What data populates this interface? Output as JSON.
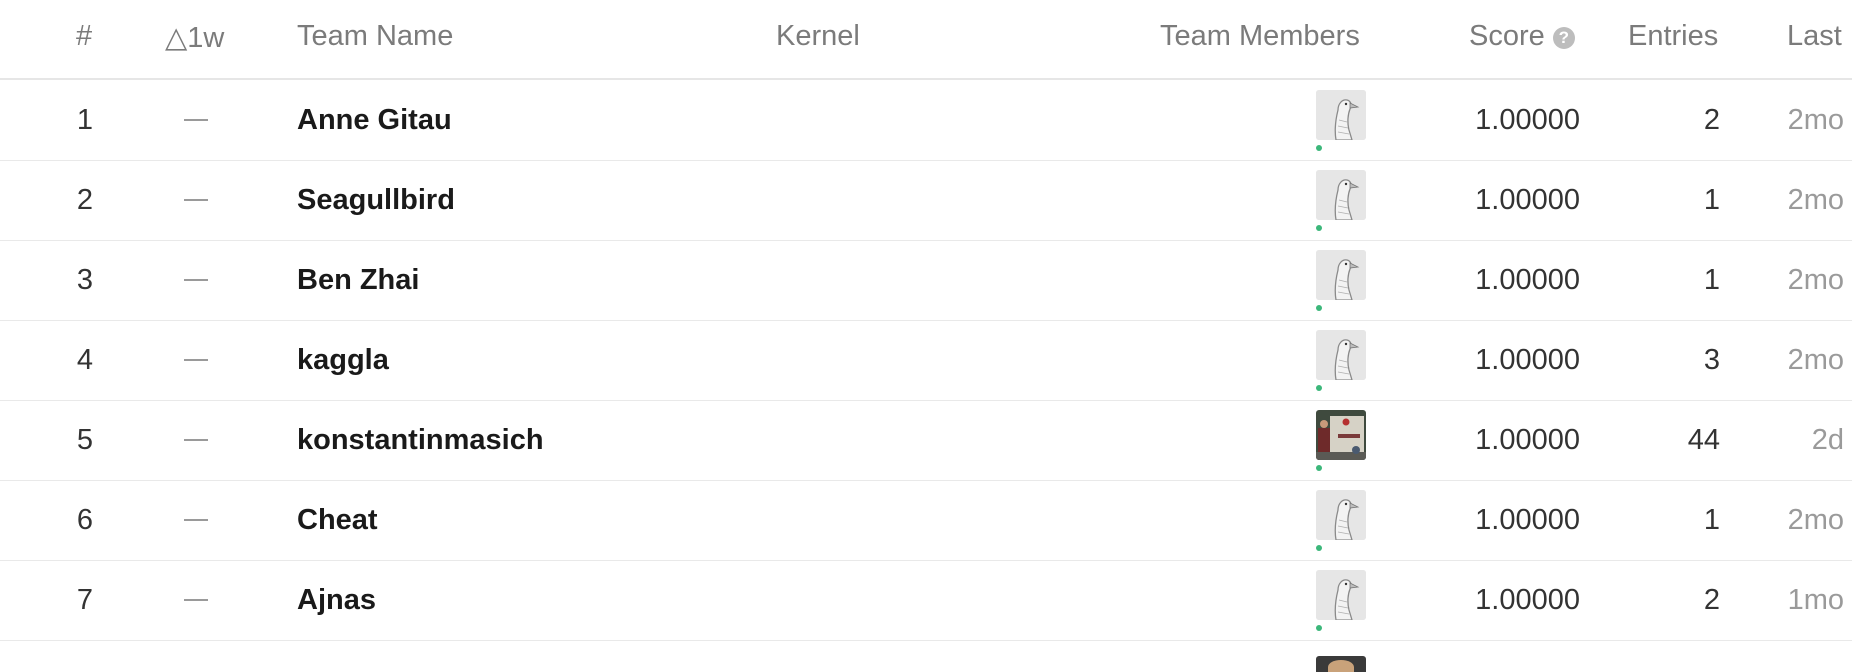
{
  "header": {
    "rank": "#",
    "delta": "△1w",
    "team_name": "Team Name",
    "kernel": "Kernel",
    "team_members": "Team Members",
    "score": "Score",
    "score_help": "?",
    "entries": "Entries",
    "last": "Last"
  },
  "rows": [
    {
      "rank": "1",
      "delta": "—",
      "team": "Anne Gitau",
      "avatar": "goose-avatar",
      "score": "1.00000",
      "entries": "2",
      "last": "2mo"
    },
    {
      "rank": "2",
      "delta": "—",
      "team": "Seagullbird",
      "avatar": "goose-avatar",
      "score": "1.00000",
      "entries": "1",
      "last": "2mo"
    },
    {
      "rank": "3",
      "delta": "—",
      "team": "Ben Zhai",
      "avatar": "goose-avatar",
      "score": "1.00000",
      "entries": "1",
      "last": "2mo"
    },
    {
      "rank": "4",
      "delta": "—",
      "team": "kaggla",
      "avatar": "goose-avatar",
      "score": "1.00000",
      "entries": "3",
      "last": "2mo"
    },
    {
      "rank": "5",
      "delta": "—",
      "team": "konstantinmasich",
      "avatar": "photo-avatar",
      "score": "1.00000",
      "entries": "44",
      "last": "2d"
    },
    {
      "rank": "6",
      "delta": "—",
      "team": "Cheat",
      "avatar": "goose-avatar",
      "score": "1.00000",
      "entries": "1",
      "last": "2mo"
    },
    {
      "rank": "7",
      "delta": "—",
      "team": "Ajnas",
      "avatar": "goose-avatar",
      "score": "1.00000",
      "entries": "2",
      "last": "1mo"
    }
  ],
  "colors": {
    "online_dot": "#3bb77a",
    "header_text": "#7b7b7b",
    "muted": "#9a9a9a"
  }
}
